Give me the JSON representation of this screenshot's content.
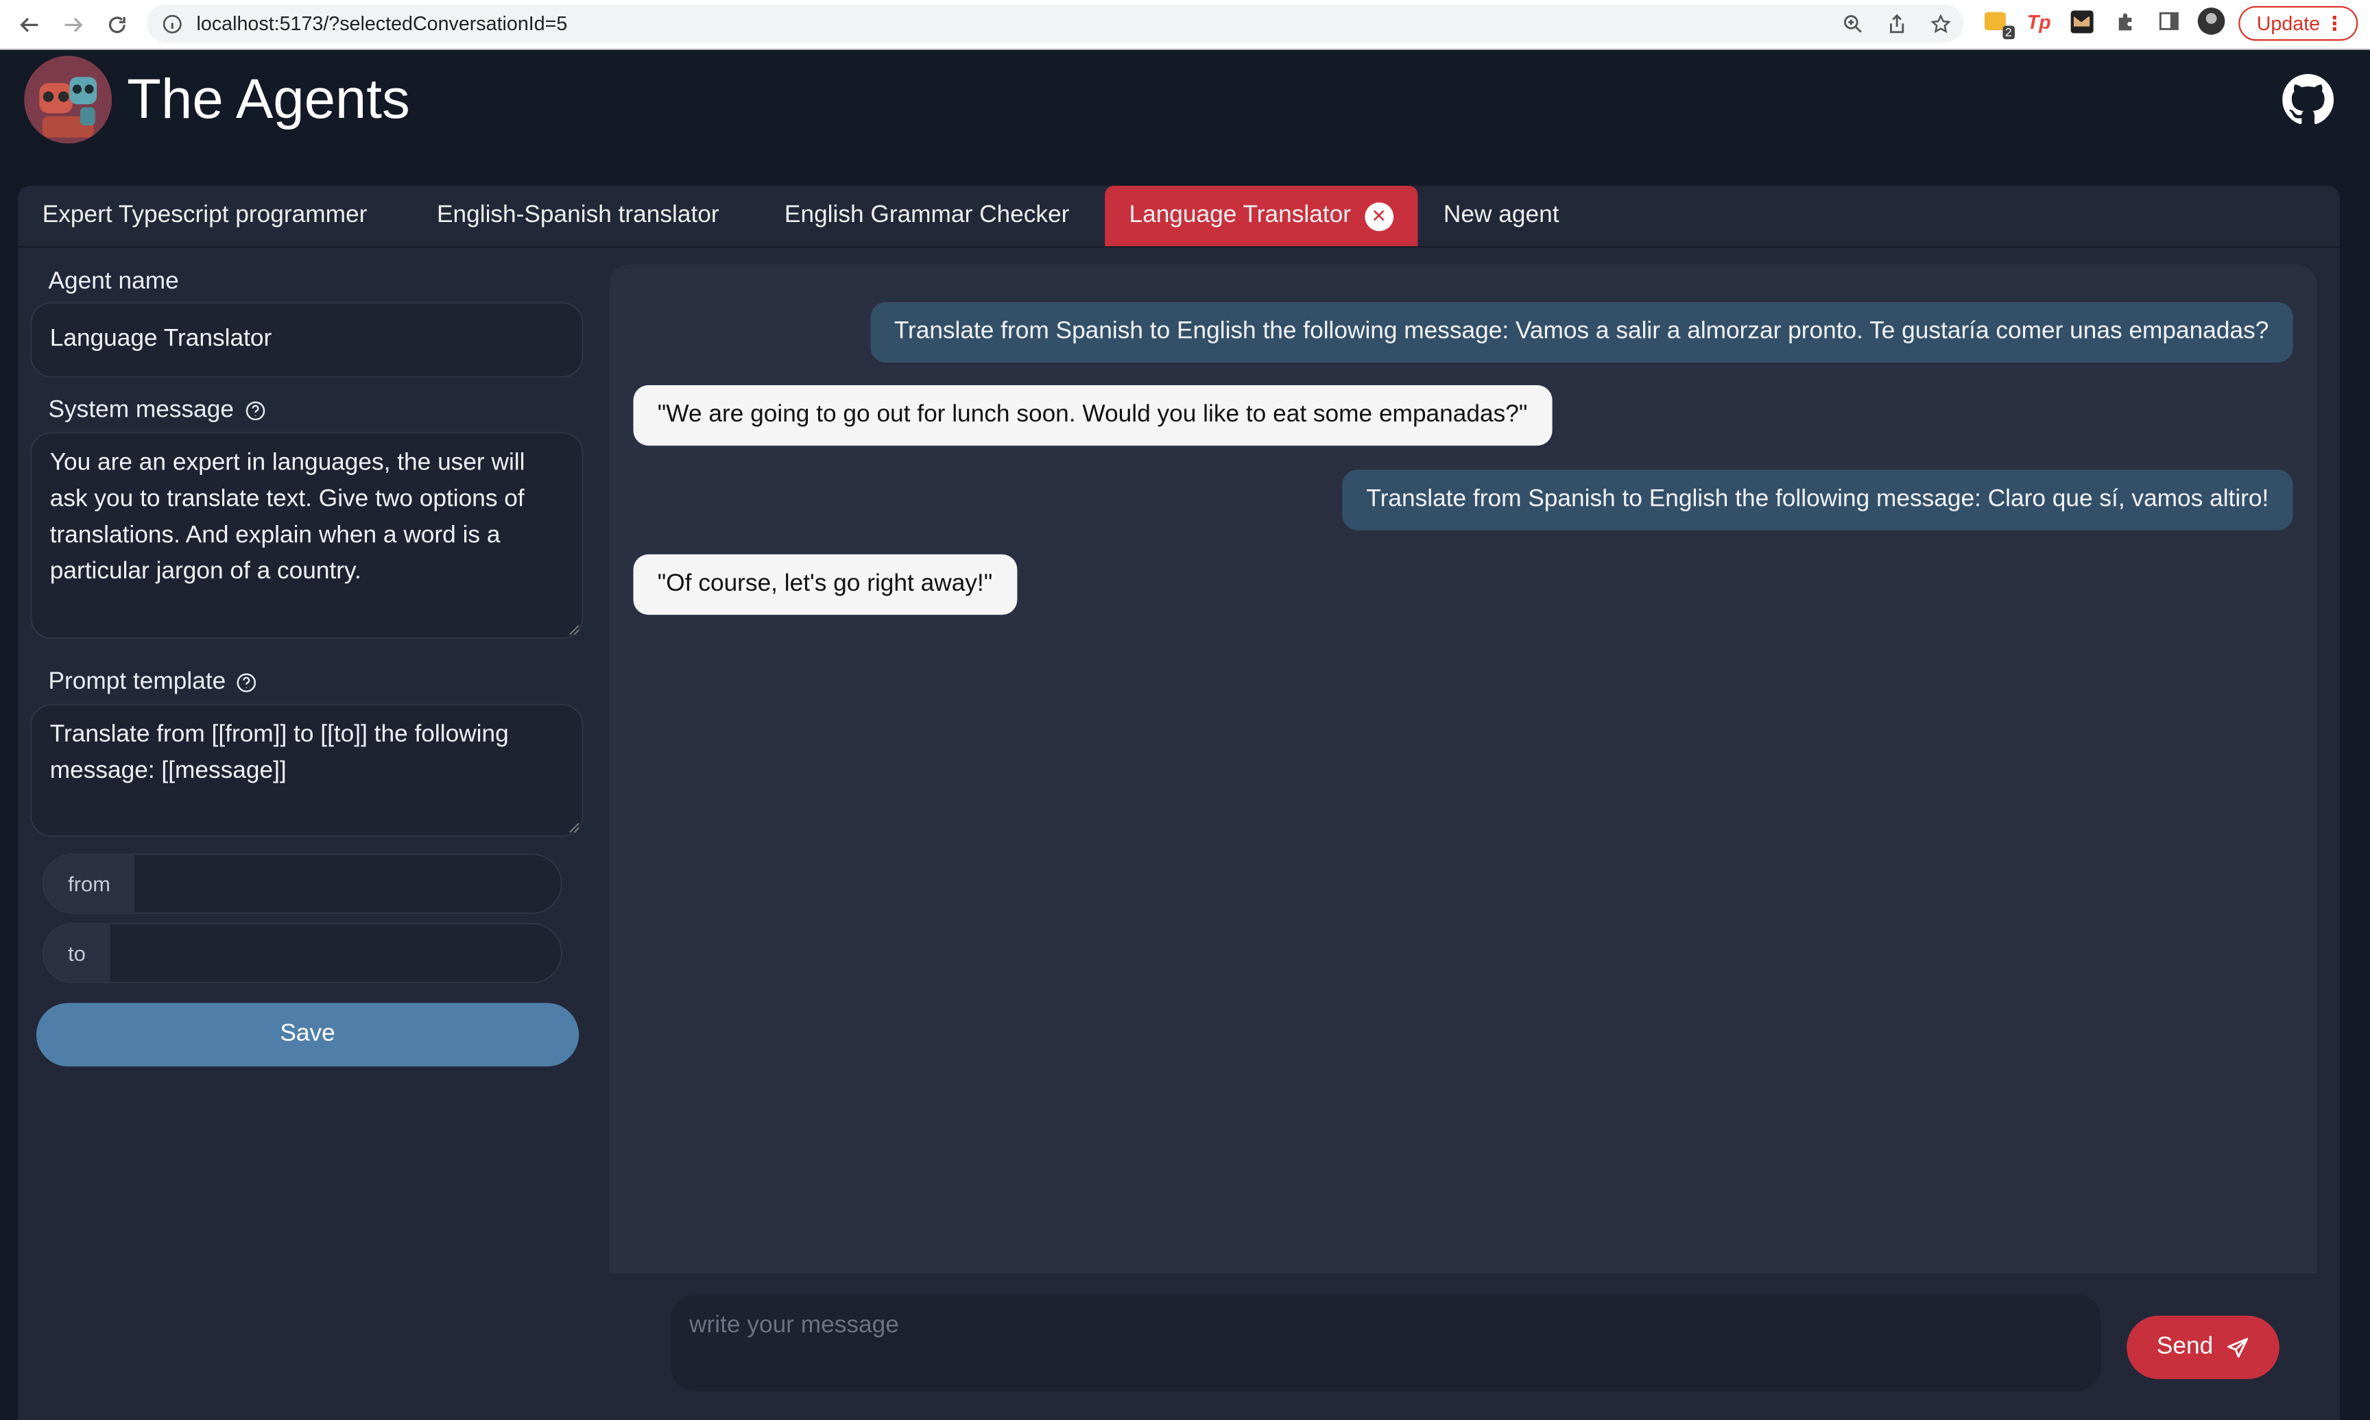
{
  "browser": {
    "url": "localhost:5173/?selectedConversationId=5",
    "update_label": "Update",
    "extension_badge": "2"
  },
  "app": {
    "title": "The Agents"
  },
  "tabs": [
    {
      "label": "Expert Typescript programmer",
      "active": false
    },
    {
      "label": "English-Spanish translator",
      "active": false
    },
    {
      "label": "English Grammar Checker",
      "active": false
    },
    {
      "label": "Language Translator",
      "active": true
    },
    {
      "label": "New agent",
      "active": false
    }
  ],
  "sidebar": {
    "agent_name_label": "Agent name",
    "agent_name_value": "Language Translator",
    "system_message_label": "System message",
    "system_message_value": "You are an expert in languages, the user will ask you to translate text. Give two options of translations. And explain when a word is a particular jargon of a country.",
    "prompt_template_label": "Prompt template",
    "prompt_template_value": "Translate from [[from]] to [[to]] the following message: [[message]]",
    "params": [
      {
        "label": "from",
        "value": ""
      },
      {
        "label": "to",
        "value": ""
      }
    ],
    "save_label": "Save"
  },
  "chat": {
    "messages": [
      {
        "role": "user",
        "text": "Translate from Spanish to English the following message: Vamos a salir a almorzar pronto. Te gustaría comer unas empanadas?"
      },
      {
        "role": "assistant",
        "text": "\"We are going to go out for lunch soon. Would you like to eat some empanadas?\""
      },
      {
        "role": "user",
        "text": "Translate from Spanish to English the following message: Claro que sí, vamos altiro!"
      },
      {
        "role": "assistant",
        "text": "\"Of course, let's go right away!\""
      }
    ],
    "input_placeholder": "write your message",
    "send_label": "Send"
  },
  "colors": {
    "accent": "#c8303d",
    "save_button": "#4f7fa8",
    "user_bubble": "#345069",
    "assistant_bubble": "#f5f5f5",
    "background": "#141926",
    "panel": "#232838"
  }
}
